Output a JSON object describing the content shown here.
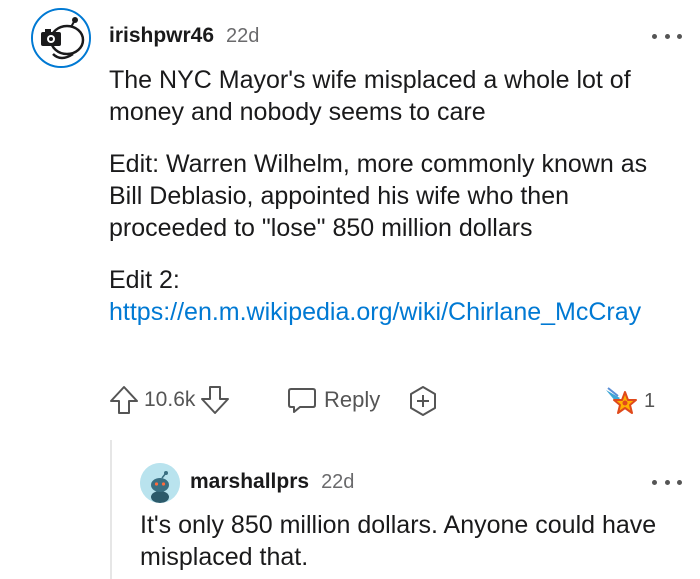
{
  "comment": {
    "username": "irishpwr46",
    "age": "22d",
    "paragraphs": [
      "The NYC Mayor's wife misplaced a whole lot of money and nobody seems to care",
      "Edit: Warren Wilhelm, more commonly known as Bill Deblasio, appointed his wife who then proceeded to \"lose\" 850 million dollars"
    ],
    "edit2_label": "Edit 2:",
    "link_text": "https://en.m.wikipedia.org/wiki/Chirlane_McCray",
    "vote_count": "10.6k",
    "reply_label": "Reply",
    "award_count": "1",
    "icons": {
      "upvote": "upvote-arrow-icon",
      "downvote": "downvote-arrow-icon",
      "reply": "speech-bubble-icon",
      "award": "add-award-icon",
      "received_award": "rocket-star-award-icon",
      "more": "more-options-icon"
    }
  },
  "reply": {
    "username": "marshallprs",
    "age": "22d",
    "text": "It's only 850 million dollars. Anyone could have misplaced that."
  },
  "colors": {
    "link": "#0079d3",
    "text": "#1a1a1b",
    "muted": "#6a6a6c",
    "thread_line": "#e6e6e6"
  }
}
